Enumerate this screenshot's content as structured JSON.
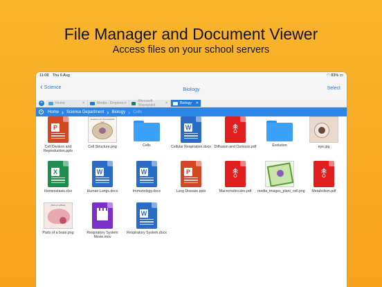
{
  "headline": "File Manager and Document Viewer",
  "subline": "Access files on your school servers",
  "status": {
    "time": "11:08",
    "date": "Thu 6 Aug",
    "battery": "83%"
  },
  "nav": {
    "back": "Science",
    "title": "Biology",
    "select": "Select"
  },
  "tabs": [
    {
      "label": "Home",
      "color": "#4aa3d8"
    },
    {
      "label": "Media - Dropbox",
      "color": "#1f7ae0"
    },
    {
      "label": "Microsoft Sharepoint",
      "color": "#0f7b7b"
    },
    {
      "label": "Biology",
      "color": "#ffffff"
    }
  ],
  "path": [
    "Home",
    "Science Department",
    "Biology",
    "Cells"
  ],
  "files": [
    {
      "name": "Cell Division and Reproduction.pptx",
      "kind": "ppt",
      "badge": "P"
    },
    {
      "name": "Cell Structure.png",
      "kind": "image",
      "caption": "Anatomy of a Generalized Cell"
    },
    {
      "name": "Cells",
      "kind": "folder"
    },
    {
      "name": "Cellular Respiration.docx",
      "kind": "word",
      "badge": "W"
    },
    {
      "name": "Diffusion and Osmosis.pdf",
      "kind": "pdf"
    },
    {
      "name": "Evolution",
      "kind": "folder"
    },
    {
      "name": "eye.jpg",
      "kind": "image"
    },
    {
      "name": "Homeostasis.xlsx",
      "kind": "xls",
      "badge": "X"
    },
    {
      "name": "Human Lungs.docx",
      "kind": "word",
      "badge": "W"
    },
    {
      "name": "Immunology.docx",
      "kind": "word",
      "badge": "W"
    },
    {
      "name": "Lung Disease.pptx",
      "kind": "ppt",
      "badge": "P"
    },
    {
      "name": "Macromolecules.pdf",
      "kind": "pdf"
    },
    {
      "name": "media_images_plant_cell.png",
      "kind": "image"
    },
    {
      "name": "Metabolism.pdf",
      "kind": "pdf"
    },
    {
      "name": "Parts of a brain.png",
      "kind": "image",
      "caption": "Parts of a Brain"
    },
    {
      "name": "Respiratory System Movie.mov",
      "kind": "mov"
    },
    {
      "name": "Respiratory System.docx",
      "kind": "word",
      "badge": "W"
    }
  ]
}
